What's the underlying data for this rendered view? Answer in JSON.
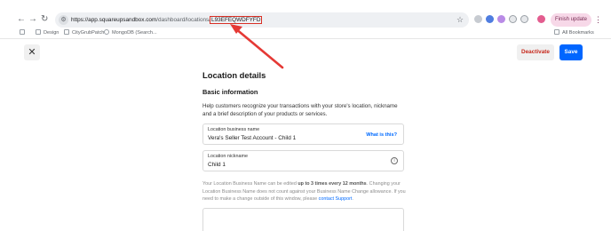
{
  "browser": {
    "url_host": "https://app.squareupsandbox.com",
    "url_path": "/dashboard/locations/",
    "url_highlight": "L93EFEQWDFYFD",
    "finish_update_label": "Finish update",
    "bookmarks": [
      "Design",
      "CityGrubPatch",
      "MongoDB (Search..."
    ],
    "all_bookmarks_label": "All Bookmarks"
  },
  "header": {
    "close_label": "✕",
    "deactivate_label": "Deactivate",
    "save_label": "Save"
  },
  "main": {
    "title": "Location details",
    "section_title": "Basic information",
    "help_text": "Help customers recognize your transactions with your store's location, nickname and a brief description of your products or services.",
    "fields": {
      "business_name": {
        "label": "Location business name",
        "value": "Vera's Seller Test Account - Child 1",
        "link": "What is this?"
      },
      "nickname": {
        "label": "Location nickname",
        "value": "Child 1"
      }
    },
    "note": {
      "part1": "Your Location Business Name can be edited ",
      "bold": "up to 3 times every 12 months",
      "part2": ". Changing your Location Business Name does not count against your Business Name Change allowance. If you need to make a change outside of this window, please ",
      "link": "contact Support",
      "part3": "."
    }
  },
  "annotation": {
    "color": "#e53935"
  }
}
